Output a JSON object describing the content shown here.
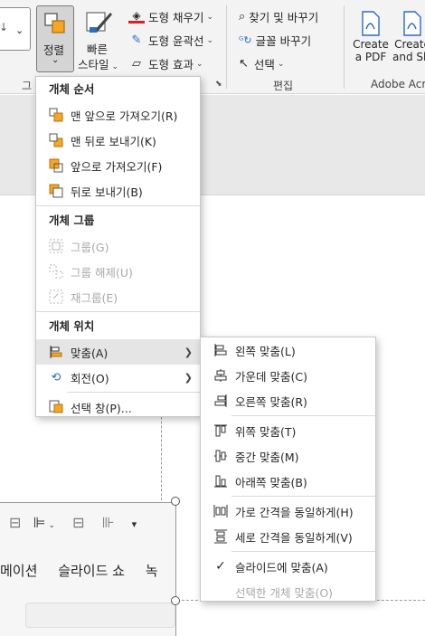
{
  "ribbon": {
    "arrange_label": "정렬",
    "quick_style_label1": "빠른",
    "quick_style_label2": "스타일",
    "shape_fill": "도형 채우기",
    "shape_outline": "도형 윤곽선",
    "shape_effects": "도형 효과",
    "find_replace": "찾기 및 바꾸기",
    "font_replace": "글꼴 바꾸기",
    "select": "선택",
    "edit_group": "편집",
    "create_pdf1": "Create",
    "create_pdf2": "a PDF",
    "create_share1": "Create",
    "create_share2": "and Sh",
    "adobe_group": "Adobe Acro",
    "partial_group": "그",
    "partial_chev": "⌄"
  },
  "arrange_menu": {
    "order_header": "개체 순서",
    "bring_front": "맨 앞으로 가져오기(R)",
    "send_back": "맨 뒤로 보내기(K)",
    "bring_forward": "앞으로 가져오기(F)",
    "send_backward": "뒤로 보내기(B)",
    "group_header": "개체 그룹",
    "group": "그룹(G)",
    "ungroup": "그룹 해제(U)",
    "regroup": "재그룹(E)",
    "position_header": "개체 위치",
    "align": "맞춤(A)",
    "rotate": "회전(O)",
    "selection_pane": "선택 창(P)..."
  },
  "align_menu": {
    "align_left": "왼쪽 맞춤(L)",
    "align_center": "가운데 맞춤(C)",
    "align_right": "오른쪽 맞춤(R)",
    "align_top": "위쪽 맞춤(T)",
    "align_middle": "중간 맞춤(M)",
    "align_bottom": "아래쪽 맞춤(B)",
    "distribute_h": "가로 간격을 동일하게(H)",
    "distribute_v": "세로 간격을 동일하게(V)",
    "align_to_slide": "슬라이드에 맞춤(A)",
    "align_selected": "선택한 개체 맞춤(O)"
  },
  "mini": {
    "tab_animation": "메이션",
    "tab_slideshow": "슬라이드 쇼",
    "tab_record": "녹"
  },
  "colors": {
    "accent_orange": "#f5a623",
    "fill_underline": "#e02020",
    "pdf_blue": "#2b6cc4"
  }
}
